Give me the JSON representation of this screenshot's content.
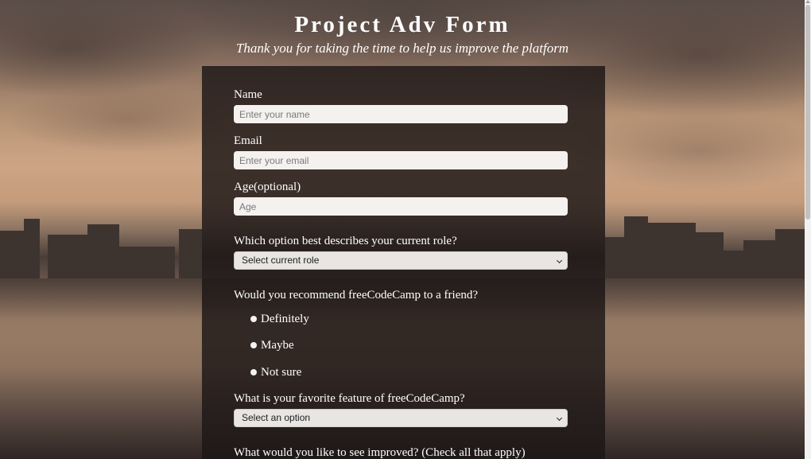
{
  "header": {
    "title": "Project Adv Form",
    "subtitle": "Thank you for taking the time to help us improve the platform"
  },
  "form": {
    "name": {
      "label": "Name",
      "placeholder": "Enter your name",
      "value": ""
    },
    "email": {
      "label": "Email",
      "placeholder": "Enter your email",
      "value": ""
    },
    "age": {
      "label": "Age(optional)",
      "placeholder": "Age",
      "value": ""
    },
    "role": {
      "label": "Which option best describes your current role?",
      "selected": "Select current role"
    },
    "recommend": {
      "label": "Would you recommend freeCodeCamp to a friend?",
      "options": [
        "Definitely",
        "Maybe",
        "Not sure"
      ]
    },
    "favorite_feature": {
      "label": "What is your favorite feature of freeCodeCamp?",
      "selected": "Select an option"
    },
    "improvements": {
      "label": "What would you like to see improved? (Check all that apply)"
    }
  },
  "colors": {
    "panel_background": "#1c1616",
    "input_background": "#f4f1ef",
    "text": "#ffffff"
  },
  "icons": {
    "select_arrow": "chevron-down-icon",
    "radio": "radio-button-icon"
  }
}
